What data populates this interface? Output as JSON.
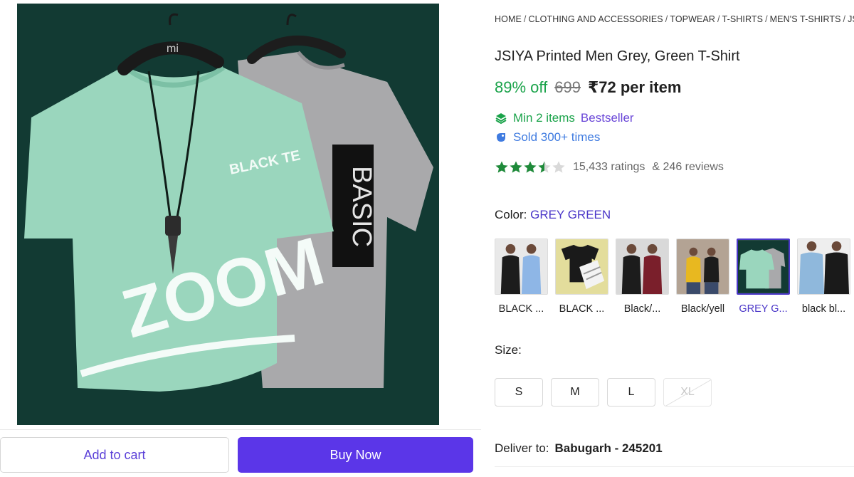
{
  "buttons": {
    "add_to_cart": "Add to cart",
    "buy_now": "Buy Now"
  },
  "hero": {
    "hanger_left_text": "mi",
    "left_shirt_chest_text": "BLACK TE",
    "left_shirt_print": "ZOOM",
    "right_shirt_print": "BASIC"
  },
  "breadcrumb": {
    "items": [
      "HOME",
      "CLOTHING AND ACCESSORIES",
      "TOPWEAR",
      "T-SHIRTS",
      "MEN'S T-SHIRTS",
      "JSI"
    ],
    "separator": "/"
  },
  "product": {
    "title": "JSIYA Printed Men Grey, Green T-Shirt",
    "discount": "89% off",
    "mrp": "699",
    "price": "₹72 per item",
    "min_items": "Min 2 items",
    "bestseller": "Bestseller",
    "sold": "Sold 300+ times",
    "rating_value": 3.5,
    "ratings": "15,433 ratings",
    "reviews": "& 246 reviews"
  },
  "color": {
    "label": "Color:",
    "selected": "GREY GREEN",
    "options": [
      {
        "label": "BLACK ...",
        "icon": "black-white-sweatshirts-thumbnail"
      },
      {
        "label": "BLACK ...",
        "icon": "black-white-tshirts-thumbnail"
      },
      {
        "label": "Black/...",
        "icon": "black-maroon-sweatshirts-thumbnail"
      },
      {
        "label": "Black/yell",
        "icon": "black-yellow-sweatshirts-thumbnail"
      },
      {
        "label": "GREY G...",
        "icon": "grey-green-tshirts-thumbnail"
      },
      {
        "label": "black bl...",
        "icon": "black-blue-sweatshirts-thumbnail"
      }
    ]
  },
  "size": {
    "label": "Size:",
    "options": [
      "S",
      "M",
      "L",
      "XL"
    ]
  },
  "delivery": {
    "label": "Deliver to:",
    "location": "Babugarh - 245201"
  },
  "colors": {
    "accent": "#5b36e8",
    "green": "#1aa34a",
    "selected": "#4a36c8",
    "hero_bg": "#123a33"
  }
}
